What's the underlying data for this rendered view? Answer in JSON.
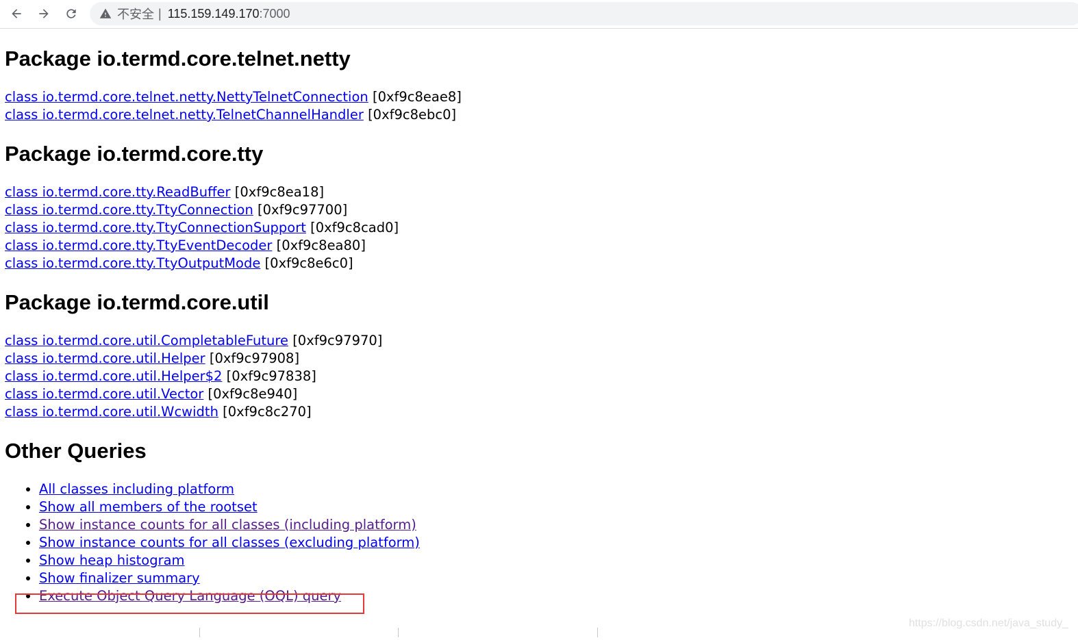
{
  "browser": {
    "security_label": "不安全",
    "separator": "|",
    "url_host": "115.159.149.170",
    "url_port": ":7000"
  },
  "sections": [
    {
      "title": "Package io.termd.core.telnet.netty",
      "entries": [
        {
          "link": "class io.termd.core.telnet.netty.NettyTelnetConnection",
          "addr": "[0xf9c8eae8]"
        },
        {
          "link": "class io.termd.core.telnet.netty.TelnetChannelHandler",
          "addr": "[0xf9c8ebc0]"
        }
      ]
    },
    {
      "title": "Package io.termd.core.tty",
      "entries": [
        {
          "link": "class io.termd.core.tty.ReadBuffer",
          "addr": "[0xf9c8ea18]"
        },
        {
          "link": "class io.termd.core.tty.TtyConnection",
          "addr": "[0xf9c97700]"
        },
        {
          "link": "class io.termd.core.tty.TtyConnectionSupport",
          "addr": "[0xf9c8cad0]"
        },
        {
          "link": "class io.termd.core.tty.TtyEventDecoder",
          "addr": "[0xf9c8ea80]"
        },
        {
          "link": "class io.termd.core.tty.TtyOutputMode",
          "addr": "[0xf9c8e6c0]"
        }
      ]
    },
    {
      "title": "Package io.termd.core.util",
      "entries": [
        {
          "link": "class io.termd.core.util.CompletableFuture",
          "addr": "[0xf9c97970]"
        },
        {
          "link": "class io.termd.core.util.Helper",
          "addr": "[0xf9c97908]"
        },
        {
          "link": "class io.termd.core.util.Helper$2",
          "addr": "[0xf9c97838]"
        },
        {
          "link": "class io.termd.core.util.Vector",
          "addr": "[0xf9c8e940]"
        },
        {
          "link": "class io.termd.core.util.Wcwidth",
          "addr": "[0xf9c8c270]"
        }
      ]
    }
  ],
  "other_queries": {
    "title": "Other Queries",
    "items": [
      "All classes including platform",
      "Show all members of the rootset",
      "Show instance counts for all classes (including platform)",
      "Show instance counts for all classes (excluding platform)",
      "Show heap histogram",
      "Show finalizer summary",
      "Execute Object Query Language (OQL) query"
    ]
  },
  "colors": {
    "link": "#0000ee",
    "visited_link": "#551a8b",
    "highlight_border": "#e53935"
  },
  "watermark": "https://blog.csdn.net/java_study_"
}
